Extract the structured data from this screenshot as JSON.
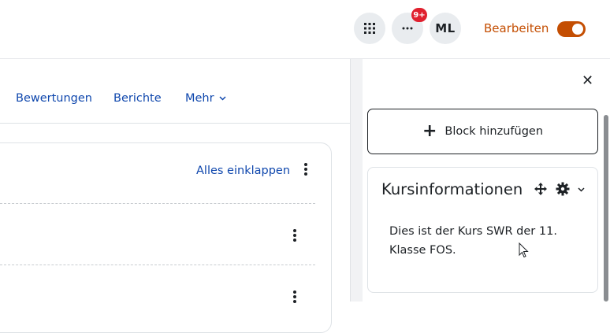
{
  "header": {
    "app_drawer_icon": "grid-icon",
    "more_icon": "ellipsis-icon",
    "notification_badge": "9+",
    "avatar_initials": "ML",
    "edit_label": "Bearbeiten",
    "edit_mode_on": true
  },
  "secondary_nav": {
    "items": [
      {
        "label": "Bewertungen"
      },
      {
        "label": "Berichte"
      },
      {
        "label": "Mehr"
      }
    ]
  },
  "course_content": {
    "collapse_all_label": "Alles einklappen"
  },
  "block_drawer": {
    "add_block_label": "Block hinzufügen",
    "blocks": [
      {
        "title": "Kursinformationen",
        "text": "Dies ist der Kurs SWR der 11. Klasse FOS."
      }
    ]
  },
  "colors": {
    "accent": "#c44e02",
    "link": "#0f47ad",
    "badge": "#e0202e",
    "text": "#1d2125"
  }
}
